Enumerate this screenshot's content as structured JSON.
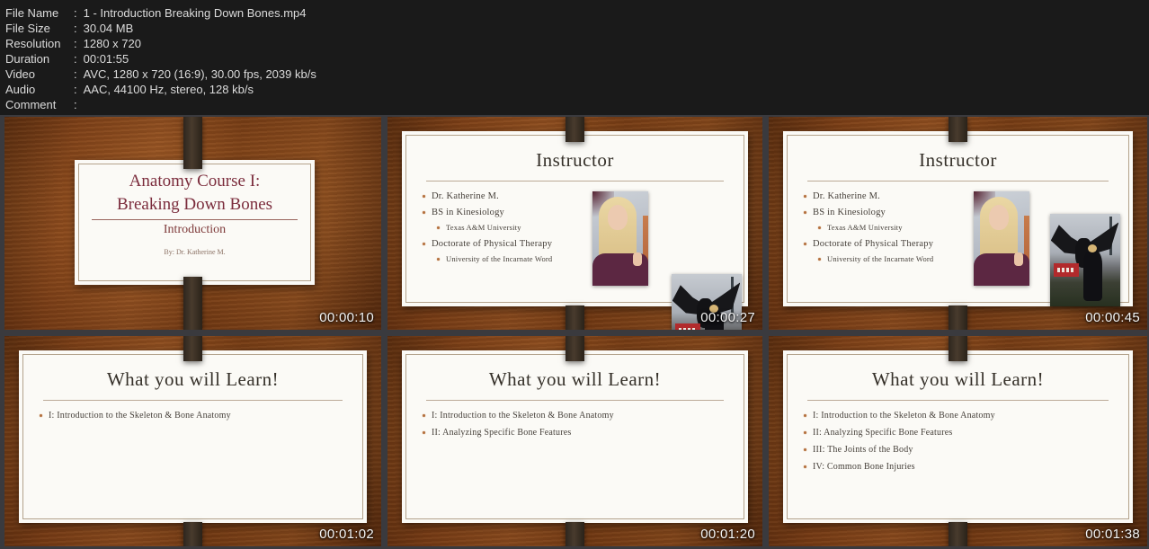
{
  "header": {
    "colon": ":",
    "rows": [
      {
        "label": "File Name",
        "value": "1 - Introduction Breaking Down Bones.mp4"
      },
      {
        "label": "File Size",
        "value": "30.04 MB"
      },
      {
        "label": "Resolution",
        "value": "1280 x 720"
      },
      {
        "label": "Duration",
        "value": "00:01:55"
      },
      {
        "label": "Video",
        "value": "AVC, 1280 x 720 (16:9), 30.00 fps, 2039 kb/s"
      },
      {
        "label": "Audio",
        "value": "AAC, 44100 Hz, stereo, 128 kb/s"
      },
      {
        "label": "Comment",
        "value": ""
      }
    ]
  },
  "colors": {
    "header_bg": "#1a1a1a",
    "grid_gap": "#3a3a3e",
    "wood": "#8a4517",
    "ribbon": "#3b3125",
    "card": "#fbfaf6",
    "title_maroon": "#7b2c3c",
    "bullet_marker": "#b5713f",
    "timestamp_text": "#f4f4f4"
  },
  "thumbnails": [
    {
      "timestamp": "00:00:10",
      "slide": {
        "title_line1": "Anatomy Course I:",
        "title_line2": "Breaking Down Bones",
        "subtitle": "Introduction",
        "byline": "By: Dr. Katherine M."
      }
    },
    {
      "timestamp": "00:00:27",
      "slide": {
        "title": "Instructor",
        "bullets": [
          {
            "level": 1,
            "text": "Dr. Katherine M."
          },
          {
            "level": 1,
            "text": "BS in Kinesiology"
          },
          {
            "level": 2,
            "text": "Texas A&M University"
          },
          {
            "level": 1,
            "text": "Doctorate of Physical Therapy"
          },
          {
            "level": 2,
            "text": "University of the Incarnate Word"
          }
        ],
        "photos": [
          "instructor-portrait",
          "graduation-eagle-photo-entering"
        ]
      }
    },
    {
      "timestamp": "00:00:45",
      "slide": {
        "title": "Instructor",
        "bullets": [
          {
            "level": 1,
            "text": "Dr. Katherine M."
          },
          {
            "level": 1,
            "text": "BS in Kinesiology"
          },
          {
            "level": 2,
            "text": "Texas A&M University"
          },
          {
            "level": 1,
            "text": "Doctorate of Physical Therapy"
          },
          {
            "level": 2,
            "text": "University of the Incarnate Word"
          }
        ],
        "photos": [
          "instructor-portrait",
          "graduation-eagle-photo"
        ]
      }
    },
    {
      "timestamp": "00:01:02",
      "slide": {
        "title": "What you will Learn!",
        "bullets": [
          {
            "level": 1,
            "text": "I: Introduction to the Skeleton & Bone Anatomy"
          }
        ]
      }
    },
    {
      "timestamp": "00:01:20",
      "slide": {
        "title": "What you will Learn!",
        "bullets": [
          {
            "level": 1,
            "text": "I: Introduction to the Skeleton & Bone Anatomy"
          },
          {
            "level": 1,
            "text": "II: Analyzing Specific Bone Features"
          }
        ]
      }
    },
    {
      "timestamp": "00:01:38",
      "slide": {
        "title": "What you will Learn!",
        "bullets": [
          {
            "level": 1,
            "text": "I: Introduction to the Skeleton & Bone Anatomy"
          },
          {
            "level": 1,
            "text": "II: Analyzing Specific Bone Features"
          },
          {
            "level": 1,
            "text": "III: The Joints of the Body"
          },
          {
            "level": 1,
            "text": "IV: Common Bone Injuries"
          }
        ]
      }
    }
  ]
}
